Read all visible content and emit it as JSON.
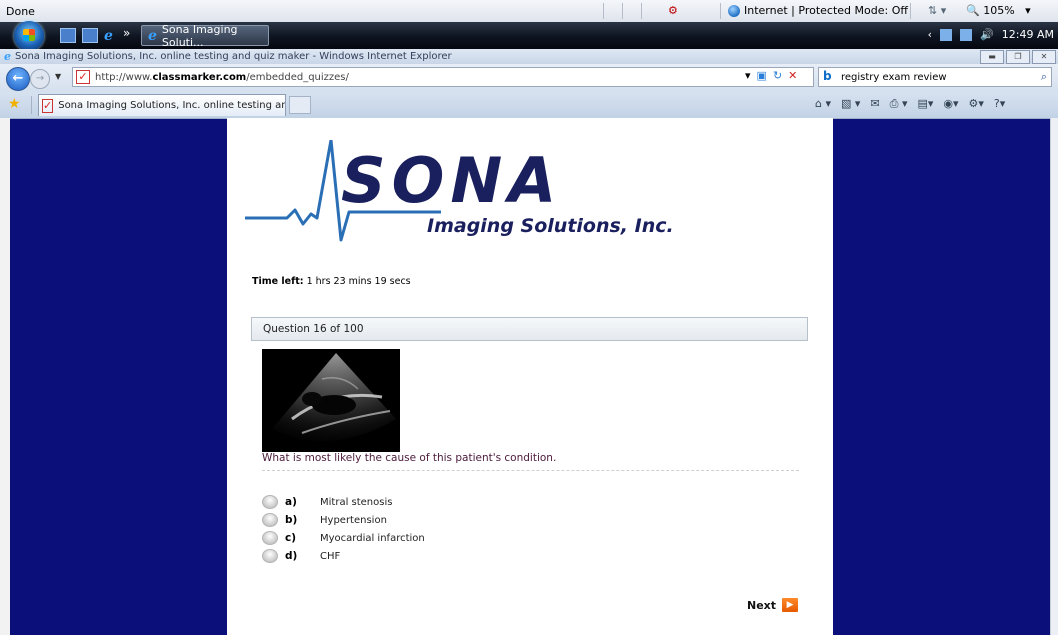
{
  "status_bar": {
    "status": "Done",
    "zone": "Internet | Protected Mode: Off",
    "zoom": "105%"
  },
  "taskbar": {
    "task_label": "Sona Imaging Soluti...",
    "clock": "12:49 AM"
  },
  "window": {
    "title": "Sona Imaging Solutions, Inc. online testing and quiz maker - Windows Internet Explorer"
  },
  "address_bar": {
    "url_prefix": "http://www.",
    "url_domain": "classmarker.com",
    "url_path": "/embedded_quizzes/",
    "search_query": "registry exam review"
  },
  "tabs": [
    {
      "label": "Sona Imaging Solutions, Inc. online testing and q..."
    }
  ],
  "logo": {
    "brand": "SONA",
    "tagline": "Imaging Solutions, Inc."
  },
  "quiz": {
    "time_left_label": "Time left:",
    "time_left_value": "1 hrs 23 mins 19 secs",
    "question_header": "Question 16 of 100",
    "question_text": "What is most likely the cause of this patient's condition.",
    "options": [
      {
        "letter": "a)",
        "text": "Mitral stenosis"
      },
      {
        "letter": "b)",
        "text": "Hypertension"
      },
      {
        "letter": "c)",
        "text": "Myocardial infarction"
      },
      {
        "letter": "d)",
        "text": "CHF"
      }
    ],
    "next_label": "Next"
  },
  "colors": {
    "background": "#0b0f7a",
    "logo_navy": "#1a1f5e",
    "logo_blue": "#2a6fb5",
    "question_text": "#4b1a3a"
  }
}
